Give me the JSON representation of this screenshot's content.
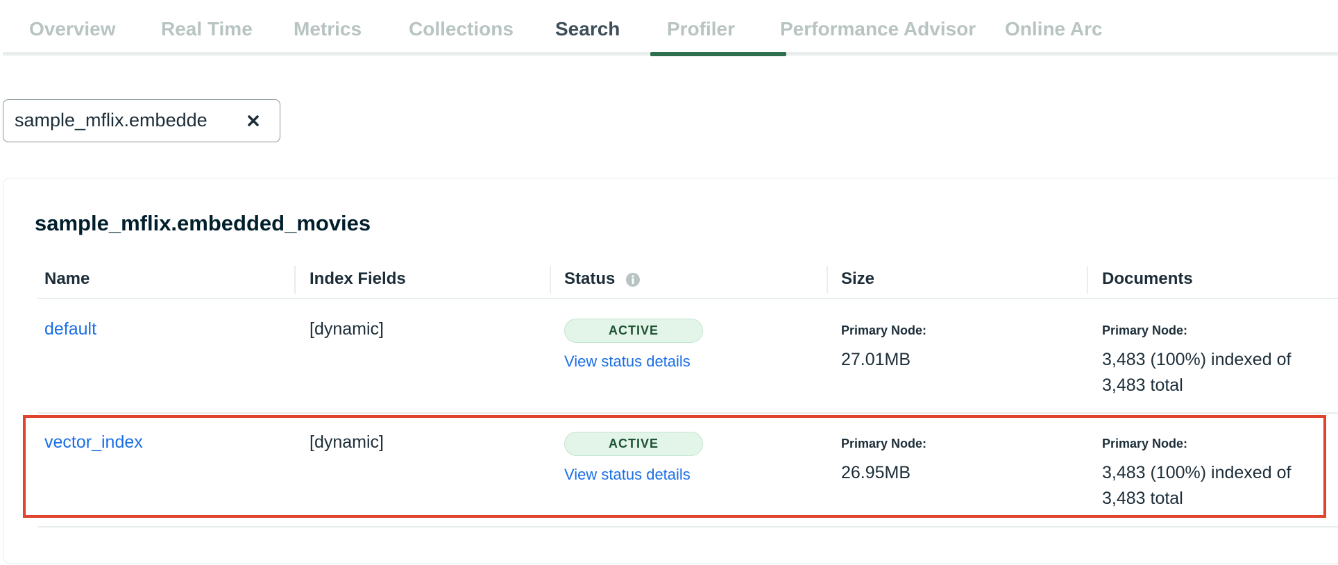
{
  "tabs": [
    {
      "label": "Overview",
      "active": false
    },
    {
      "label": "Real Time",
      "active": false
    },
    {
      "label": "Metrics",
      "active": false
    },
    {
      "label": "Collections",
      "active": false
    },
    {
      "label": "Search",
      "active": true
    },
    {
      "label": "Profiler",
      "active": false
    },
    {
      "label": "Performance Advisor",
      "active": false
    },
    {
      "label": "Online Arc",
      "active": false
    }
  ],
  "filter": {
    "value": "sample_mflix.embedde"
  },
  "card": {
    "title": "sample_mflix.embedded_movies",
    "columns": [
      "Name",
      "Index Fields",
      "Status",
      "Size",
      "Documents"
    ],
    "rows": [
      {
        "name": "default",
        "index_fields": "[dynamic]",
        "status": "ACTIVE",
        "status_link": "View status details",
        "size_label": "Primary Node:",
        "size_value": "27.01MB",
        "docs_label": "Primary Node:",
        "docs_value": "3,483 (100%) indexed of 3,483 total"
      },
      {
        "name": "vector_index",
        "index_fields": "[dynamic]",
        "status": "ACTIVE",
        "status_link": "View status details",
        "size_label": "Primary Node:",
        "size_value": "26.95MB",
        "docs_label": "Primary Node:",
        "docs_value": "3,483 (100%) indexed of 3,483 total",
        "highlighted": true
      }
    ]
  },
  "icons": {
    "status_info": "info-circle-icon",
    "filter_close": "close-icon"
  },
  "colors": {
    "link": "#1a6ee6",
    "active_tab_underline": "#2f6f4e",
    "badge_bg": "#e3f4e8",
    "badge_text": "#1d5233",
    "highlight": "#e0432e"
  }
}
